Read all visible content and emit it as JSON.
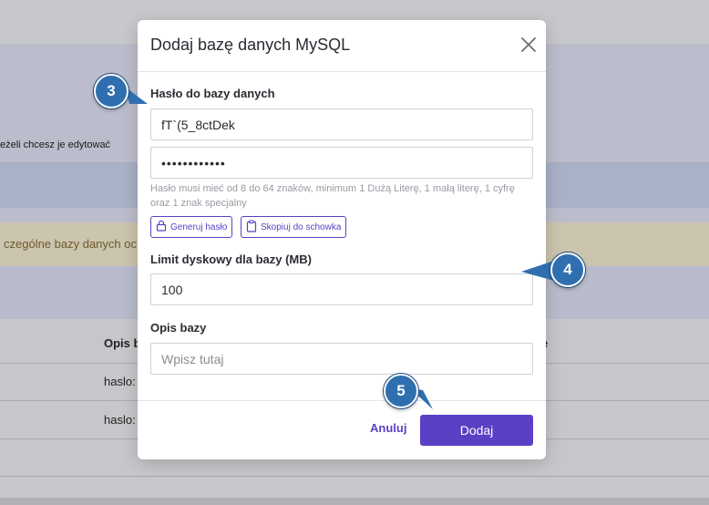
{
  "background": {
    "hint_text": "eżeli chcesz je edytować",
    "notice_text": "czególne bazy danych oc",
    "table": {
      "header_col1": "Opis b",
      "header_col2": "e",
      "rows": [
        "haslo:",
        "haslo:"
      ]
    }
  },
  "modal": {
    "title": "Dodaj bazę danych MySQL",
    "close_icon": "close-icon",
    "password": {
      "label": "Hasło do bazy danych",
      "plain_value": "fT`(5_8ctDek",
      "masked_value": "••••••••••••",
      "help": "Hasło musi mieć od 8 do 64 znaków, minimum 1 Dużą Literę, 1 małą literę, 1 cyfrę oraz 1 znak specjalny",
      "generate_label": "Generuj hasło",
      "copy_label": "Skopiuj do schowka"
    },
    "disk_limit": {
      "label": "Limit dyskowy dla bazy (MB)",
      "value": "100"
    },
    "description": {
      "label": "Opis bazy",
      "placeholder": "Wpisz tutaj"
    },
    "footer": {
      "cancel_label": "Anuluj",
      "add_label": "Dodaj"
    }
  },
  "annotations": {
    "step3": "3",
    "step4": "4",
    "step5": "5"
  },
  "colors": {
    "accent": "#5b3fc4",
    "badge": "#2f6fb0"
  }
}
